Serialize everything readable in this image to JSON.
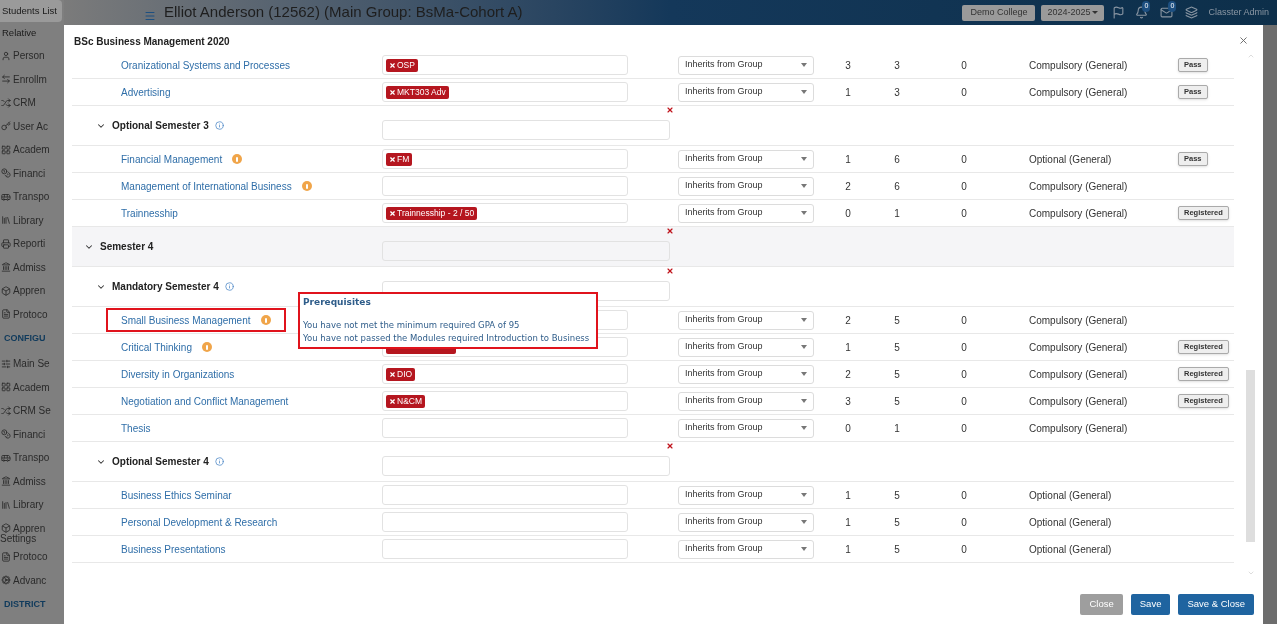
{
  "sidebar": {
    "items": [
      {
        "label": "Students List",
        "kind": "sub",
        "selected": true
      },
      {
        "label": "Relative",
        "kind": "sub",
        "selected": false
      },
      {
        "label": "Person",
        "kind": "item"
      },
      {
        "label": "Enrollm",
        "kind": "item"
      },
      {
        "label": "CRM",
        "kind": "item"
      },
      {
        "label": "User Ac",
        "kind": "item"
      },
      {
        "label": "Academ",
        "kind": "item"
      },
      {
        "label": "Financi",
        "kind": "item"
      },
      {
        "label": "Transpo",
        "kind": "item"
      },
      {
        "label": "Library",
        "kind": "item"
      },
      {
        "label": "Reporti",
        "kind": "item"
      },
      {
        "label": "Admiss",
        "kind": "item"
      },
      {
        "label": "Appren",
        "kind": "item"
      },
      {
        "label": "Protoco",
        "kind": "item"
      },
      {
        "label": "CONFIGU",
        "kind": "section"
      },
      {
        "label": "Main Se",
        "kind": "item"
      },
      {
        "label": "Academ",
        "kind": "item"
      },
      {
        "label": "CRM Se",
        "kind": "item"
      },
      {
        "label": "Financi",
        "kind": "item"
      },
      {
        "label": "Transpo",
        "kind": "item"
      },
      {
        "label": "Admiss",
        "kind": "item"
      },
      {
        "label": "Library",
        "kind": "item"
      },
      {
        "label": "Appren",
        "kind": "item"
      },
      {
        "label": "Settings",
        "kind": "cont"
      },
      {
        "label": "Protoco",
        "kind": "item"
      },
      {
        "label": "Advanc",
        "kind": "item"
      },
      {
        "label": "DISTRICT",
        "kind": "section"
      }
    ]
  },
  "header": {
    "title": "Elliot Anderson (12562) (Main Group: BsMa-Cohort A)",
    "school": "Demo College",
    "year": "2024-2025",
    "notifications": "0",
    "messages": "0",
    "user": "Classter Admin"
  },
  "modal": {
    "title": "BSc Business Management 2020",
    "rows": [
      {
        "kind": "module",
        "name": "Oranizational Systems and Processes",
        "info": false,
        "tags": [
          "OSP"
        ],
        "grading": "Inherits from Group",
        "column_1": "3",
        "column_2": "3",
        "column_3": "0",
        "column_4": "Compulsory (General)",
        "action": "Pass"
      },
      {
        "kind": "module",
        "name": "Advertising",
        "info": false,
        "tags": [
          "MKT303 Adv"
        ],
        "grading": "Inherits from Group",
        "column_1": "1",
        "column_2": "3",
        "column_3": "0",
        "column_4": "Compulsory (General)",
        "action": "Pass"
      },
      {
        "kind": "group",
        "name": "Optional Semester 3",
        "info": true
      },
      {
        "kind": "module",
        "name": "Financial Management",
        "info": true,
        "tags": [
          "FM"
        ],
        "grading": "Inherits from Group",
        "column_1": "1",
        "column_2": "6",
        "column_3": "0",
        "column_4": "Optional (General)",
        "action": "Pass"
      },
      {
        "kind": "module",
        "name": "Management of International Business",
        "info": true,
        "tags": [],
        "grading": "Inherits from Group",
        "column_1": "2",
        "column_2": "6",
        "column_3": "0",
        "column_4": "Compulsory (General)"
      },
      {
        "kind": "module",
        "name": "Trainnesship",
        "info": false,
        "tags": [
          "Trainnesship - 2 / 50"
        ],
        "grading": "Inherits from Group",
        "column_1": "0",
        "column_2": "1",
        "column_3": "0",
        "column_4": "Compulsory (General)",
        "action": "Registered"
      },
      {
        "kind": "semester",
        "name": "Semester 4",
        "info": false
      },
      {
        "kind": "group",
        "name": "Mandatory Semester 4",
        "info": true
      },
      {
        "kind": "module",
        "name": "Small Business Management",
        "info": true,
        "highlighted": true,
        "tags": [],
        "grading": "Inherits from Group",
        "column_1": "2",
        "column_2": "5",
        "column_3": "0",
        "column_4": "Compulsory (General)",
        "popover": {
          "title": "Prerequisites",
          "lines": [
            "You have not met the minimum required GPA of 95",
            "You have not passed the Modules required Introduction to Business"
          ]
        }
      },
      {
        "kind": "module",
        "name": "Critical Thinking",
        "info": true,
        "tags": [],
        "tag_covered": true,
        "grading": "Inherits from Group",
        "column_1": "1",
        "column_2": "5",
        "column_3": "0",
        "column_4": "Compulsory (General)",
        "action": "Registered"
      },
      {
        "kind": "module",
        "name": "Diversity in Organizations",
        "info": false,
        "tags": [
          "DIO"
        ],
        "grading": "Inherits from Group",
        "column_1": "2",
        "column_2": "5",
        "column_3": "0",
        "column_4": "Compulsory (General)",
        "action": "Registered"
      },
      {
        "kind": "module",
        "name": "Negotiation and Conflict Management",
        "info": false,
        "tags": [
          "N&CM"
        ],
        "grading": "Inherits from Group",
        "column_1": "3",
        "column_2": "5",
        "column_3": "0",
        "column_4": "Compulsory (General)",
        "action": "Registered"
      },
      {
        "kind": "module",
        "name": "Thesis",
        "info": false,
        "tags": [],
        "grading": "Inherits from Group",
        "column_1": "0",
        "column_2": "1",
        "column_3": "0",
        "column_4": "Compulsory (General)"
      },
      {
        "kind": "group",
        "name": "Optional Semester 4",
        "info": true
      },
      {
        "kind": "module",
        "name": "Business Ethics Seminar",
        "info": false,
        "tags": [],
        "grading": "Inherits from Group",
        "column_1": "1",
        "column_2": "5",
        "column_3": "0",
        "column_4": "Optional (General)"
      },
      {
        "kind": "module",
        "name": "Personal Development & Research",
        "info": false,
        "tags": [],
        "grading": "Inherits from Group",
        "column_1": "1",
        "column_2": "5",
        "column_3": "0",
        "column_4": "Optional (General)"
      },
      {
        "kind": "module",
        "name": "Business Presentations",
        "info": false,
        "tags": [],
        "grading": "Inherits from Group",
        "column_1": "1",
        "column_2": "5",
        "column_3": "0",
        "column_4": "Optional (General)"
      }
    ],
    "buttons": [
      {
        "label": "Close",
        "disabled": true
      },
      {
        "label": "Save",
        "disabled": false
      },
      {
        "label": "Save & Close",
        "disabled": false
      }
    ]
  }
}
